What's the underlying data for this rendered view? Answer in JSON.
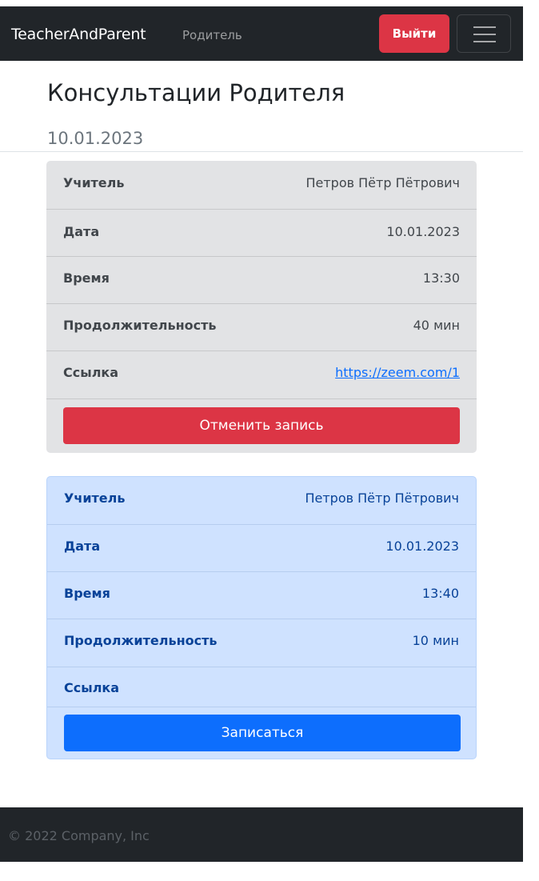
{
  "navbar": {
    "brand": "TeacherAndParent",
    "role": "Родитель",
    "logout_label": "Выйти",
    "toggler_icon": "hamburger-menu-icon"
  },
  "page": {
    "title": "Консультации Родителя",
    "date_heading": "10.01.2023"
  },
  "consultations": [
    {
      "theme": "secondary",
      "teacher_label": "Учитель",
      "teacher": "Петров Пётр Пётрович",
      "date_label": "Дата",
      "date": "10.01.2023",
      "time_label": "Время",
      "time": "13:30",
      "duration_label": "Продолжительность",
      "duration": "40 мин",
      "link_label": "Ссылка",
      "link": "https://zeem.com/1",
      "action_label": "Отменить запись",
      "action_color": "#dc3545"
    },
    {
      "theme": "primary",
      "teacher_label": "Учитель",
      "teacher": "Петров Пётр Пётрович",
      "date_label": "Дата",
      "date": "10.01.2023",
      "time_label": "Время",
      "time": "13:40",
      "duration_label": "Продолжительность",
      "duration": "10 мин",
      "link_label": "Ссылка",
      "link": "",
      "action_label": "Записаться",
      "action_color": "#0d6efd"
    }
  ],
  "footer": {
    "text": "© 2022 Company, Inc"
  },
  "colors": {
    "navbar_bg": "#212529",
    "danger": "#dc3545",
    "primary": "#0d6efd",
    "card_gray_bg": "#e2e3e5",
    "card_blue_bg": "#cfe2ff"
  }
}
